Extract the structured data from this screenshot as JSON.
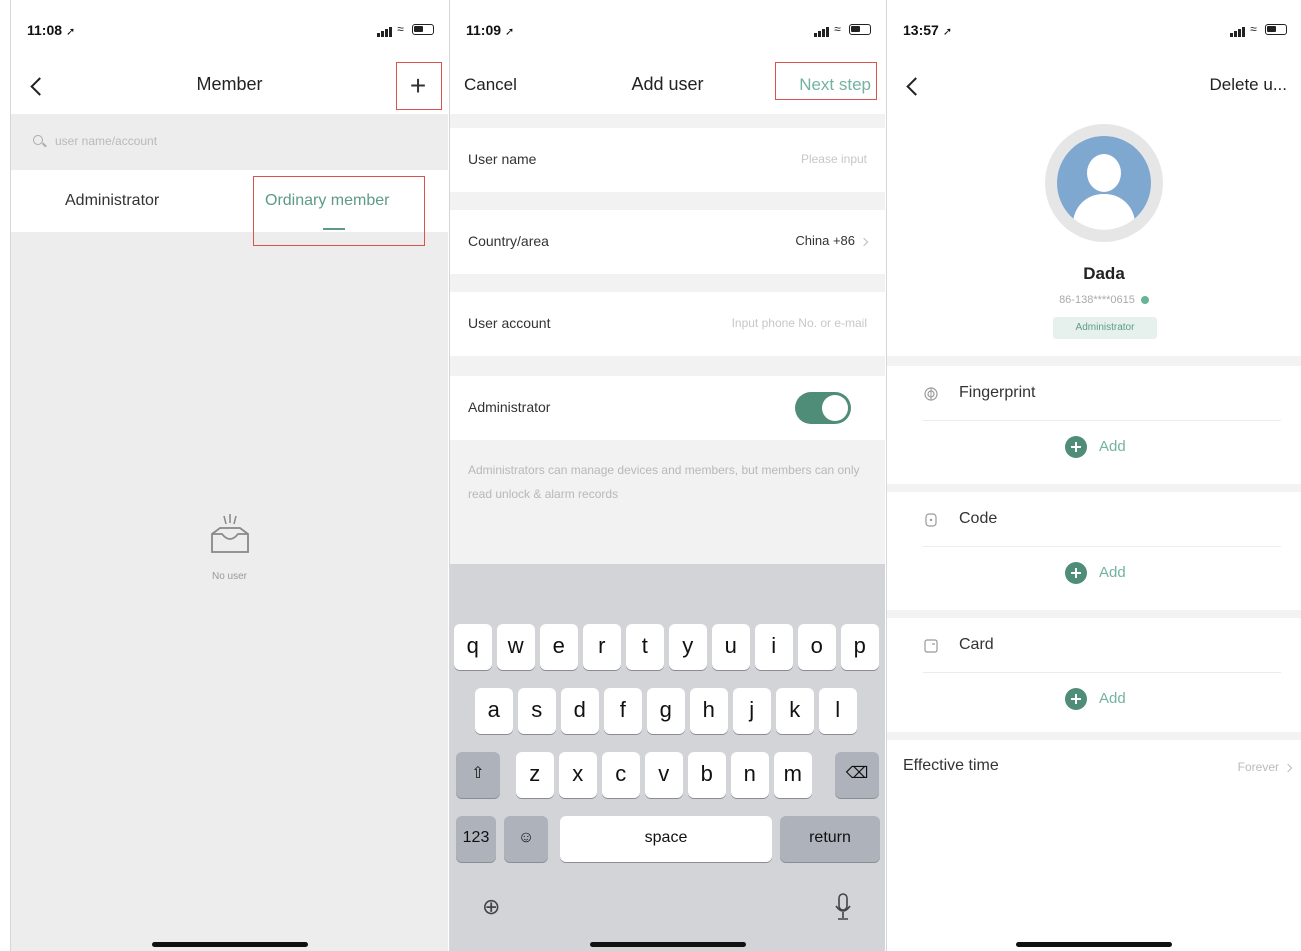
{
  "screens": {
    "member": {
      "status_time": "11:08",
      "title": "Member",
      "add_label": "+",
      "search_placeholder": "user name/account",
      "tabs": [
        "Administrator",
        "Ordinary member"
      ],
      "active_tab": "Ordinary member",
      "empty_label": "No user"
    },
    "add_user": {
      "status_time": "11:09",
      "cancel_label": "Cancel",
      "title": "Add user",
      "next_label": "Next step",
      "fields": {
        "user_name_label": "User name",
        "user_name_placeholder": "Please input",
        "country_label": "Country/area",
        "country_value": "China +86",
        "account_label": "User account",
        "account_placeholder": "Input phone No. or e-mail",
        "admin_label": "Administrator",
        "admin_enabled": true
      },
      "hint": "Administrators can manage devices and members, but members can only read unlock & alarm records",
      "keyboard": {
        "row1": [
          "q",
          "w",
          "e",
          "r",
          "t",
          "y",
          "u",
          "i",
          "o",
          "p"
        ],
        "row2": [
          "a",
          "s",
          "d",
          "f",
          "g",
          "h",
          "j",
          "k",
          "l"
        ],
        "row3": [
          "z",
          "x",
          "c",
          "v",
          "b",
          "n",
          "m"
        ],
        "numbers_key": "123",
        "space_key": "space",
        "return_key": "return"
      }
    },
    "user_detail": {
      "status_time": "13:57",
      "delete_label": "Delete u...",
      "user_name": "Dada",
      "account": "86-138****0615",
      "role_badge": "Administrator",
      "credentials": [
        {
          "name": "Fingerprint",
          "icon": "fingerprint-icon",
          "add_label": "Add"
        },
        {
          "name": "Code",
          "icon": "code-icon",
          "add_label": "Add"
        },
        {
          "name": "Card",
          "icon": "card-icon",
          "add_label": "Add"
        }
      ],
      "effective_time_label": "Effective time",
      "effective_time_value": "Forever"
    }
  },
  "colors": {
    "accent_green": "#4f8d79",
    "accent_text": "#74b2a1",
    "highlight_box": "#d9534f"
  }
}
